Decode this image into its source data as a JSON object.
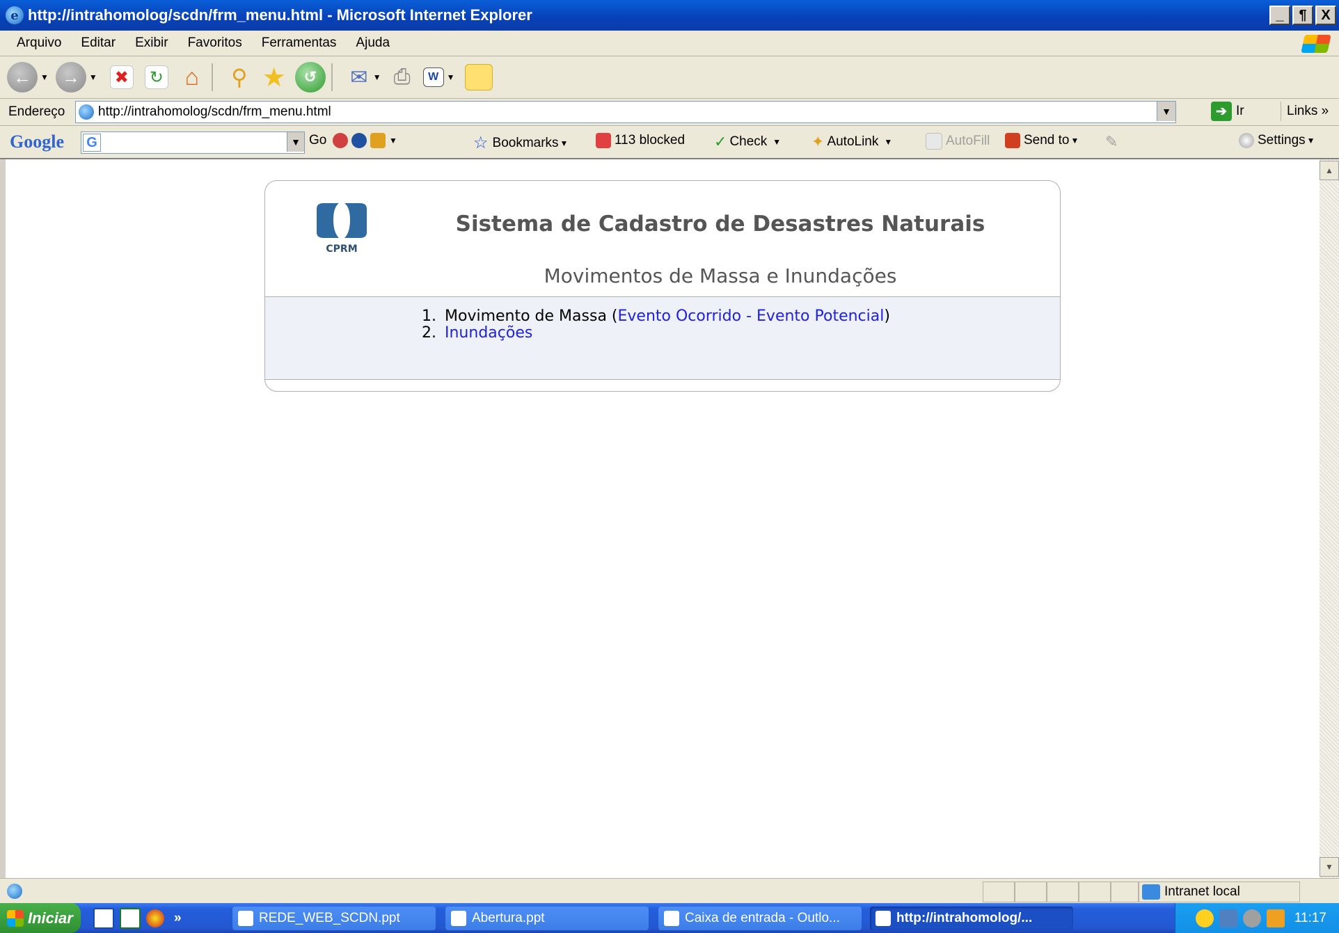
{
  "window": {
    "title": "http://intrahomolog/scdn/frm_menu.html - Microsoft Internet Explorer",
    "minimize": "_",
    "restore": "¶",
    "close": "X"
  },
  "menubar": [
    "Arquivo",
    "Editar",
    "Exibir",
    "Favoritos",
    "Ferramentas",
    "Ajuda"
  ],
  "address": {
    "label": "Endereço",
    "url": "http://intrahomolog/scdn/frm_menu.html",
    "go_label": "Ir",
    "links_label": "Links »"
  },
  "google_toolbar": {
    "logo": "Google",
    "search_letter": "G",
    "go_label": "Go",
    "bookmarks_label": "Bookmarks",
    "blocked_label": "113 blocked",
    "check_label": "Check",
    "autolink_label": "AutoLink",
    "autofill_label": "AutoFill",
    "sendto_label": "Send to",
    "settings_label": "Settings"
  },
  "page": {
    "logo_text": "CPRM",
    "title": "Sistema de Cadastro de Desastres Naturais",
    "subtitle": "Movimentos de Massa e Inundações",
    "items": [
      {
        "num": "1.",
        "text": "Movimento de Massa (",
        "link1": "Evento Ocorrido",
        "sep": " - ",
        "link2": "Evento Potencial",
        "close": ")"
      },
      {
        "num": "2.",
        "link": "Inundações"
      }
    ]
  },
  "statusbar": {
    "zone": "Intranet local"
  },
  "taskbar": {
    "start": "Iniciar",
    "more": "»",
    "tasks": [
      "REDE_WEB_SCDN.ppt",
      "Abertura.ppt",
      "Caixa de entrada - Outlo...",
      "http://intrahomolog/..."
    ],
    "clock": "11:17"
  },
  "colors": {
    "link": "#2020e0",
    "menu_bg": "#eef1f7",
    "title_text": "#555555"
  }
}
